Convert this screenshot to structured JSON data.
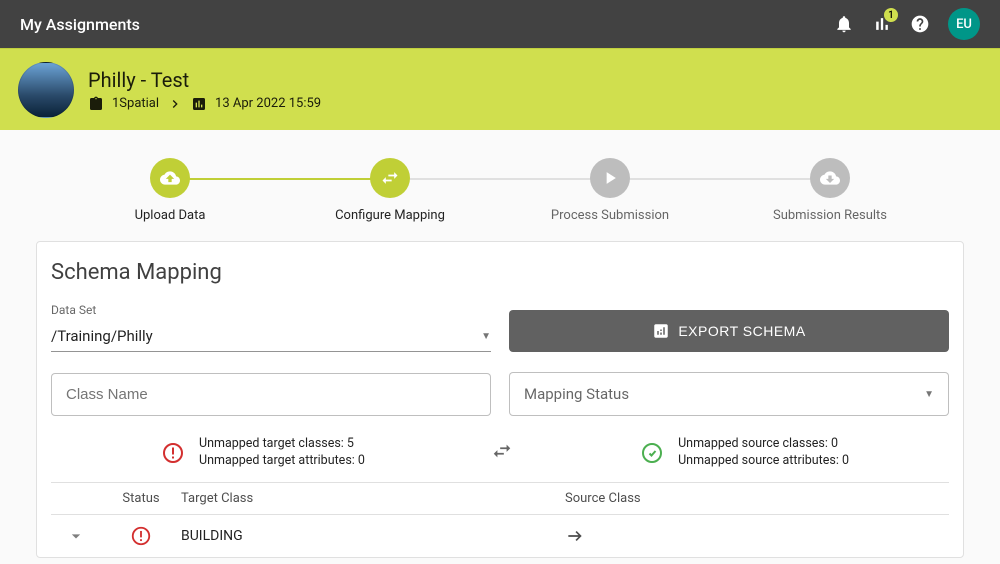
{
  "topbar": {
    "title": "My Assignments",
    "chartBadge": "1",
    "avatar": "EU"
  },
  "assignment": {
    "name": "Philly - Test",
    "org": "1Spatial",
    "timestamp": "13 Apr 2022 15:59"
  },
  "stepper": {
    "step1": "Upload Data",
    "step2": "Configure Mapping",
    "step3": "Process Submission",
    "step4": "Submission Results"
  },
  "schema": {
    "heading": "Schema Mapping",
    "dataSetLabel": "Data Set",
    "dataSetValue": "/Training/Philly",
    "exportLabel": "EXPORT SCHEMA",
    "classNamePlaceholder": "Class Name",
    "mappingStatusPlaceholder": "Mapping Status",
    "summary": {
      "unmappedTargetClasses": "Unmapped target classes: 5",
      "unmappedTargetAttrs": "Unmapped target attributes: 0",
      "unmappedSourceClasses": "Unmapped source classes: 0",
      "unmappedSourceAttrs": "Unmapped source attributes: 0"
    },
    "columns": {
      "status": "Status",
      "target": "Target Class",
      "source": "Source Class"
    },
    "rows": [
      {
        "status": "error",
        "target": "BUILDING",
        "source": ""
      }
    ]
  }
}
